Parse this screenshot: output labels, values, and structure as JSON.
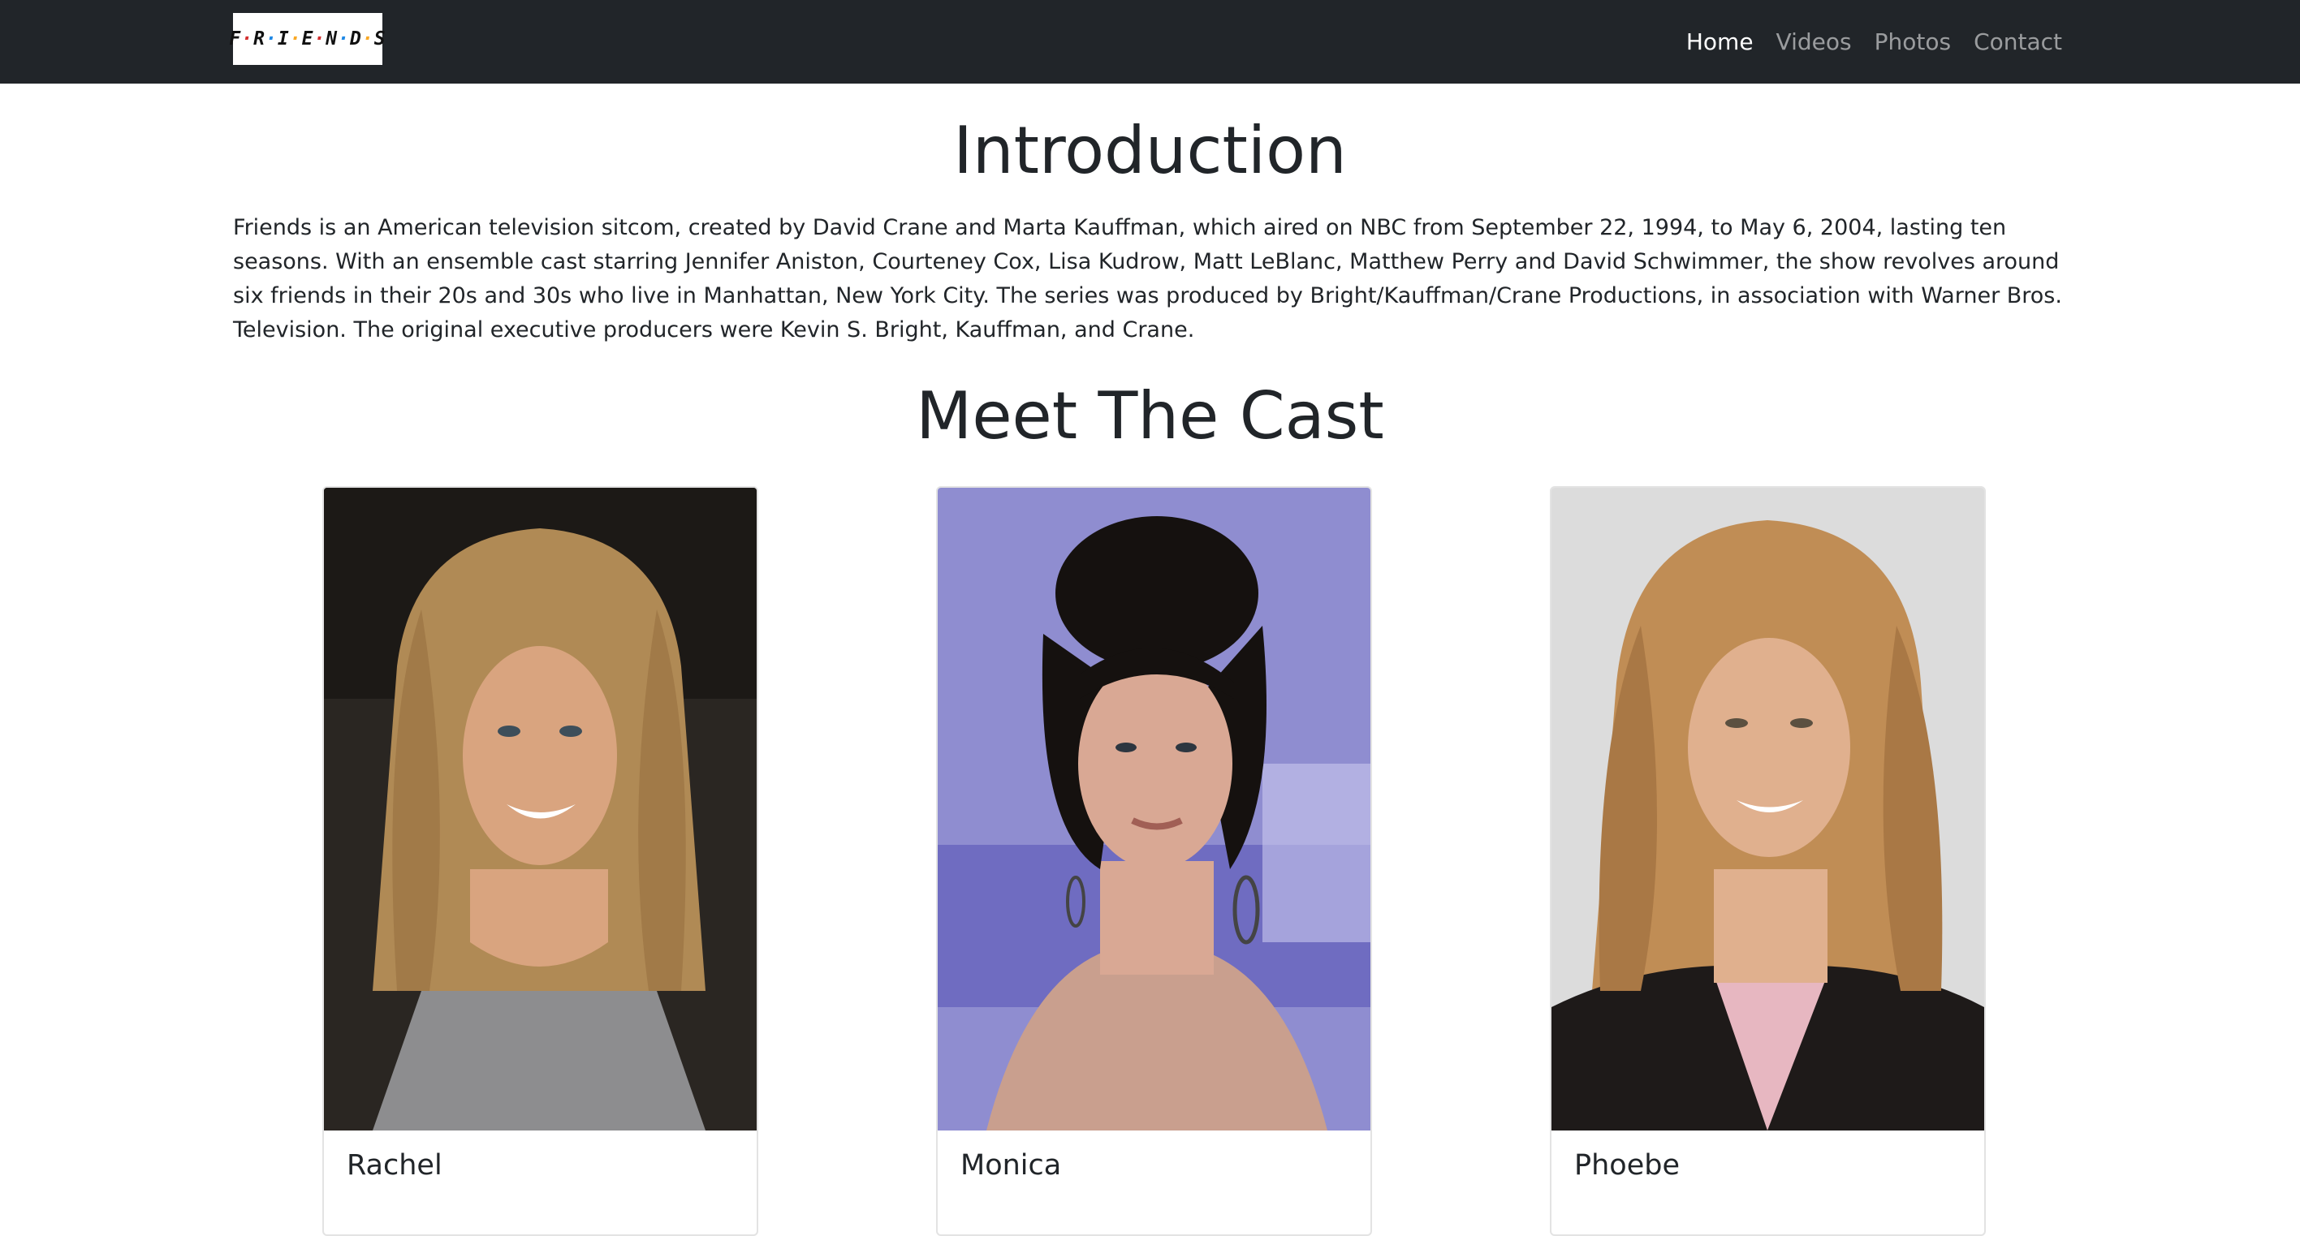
{
  "navbar": {
    "brand": {
      "letters": [
        "F",
        "R",
        "I",
        "E",
        "N",
        "D",
        "S"
      ]
    },
    "links": [
      {
        "label": "Home",
        "active": true
      },
      {
        "label": "Videos",
        "active": false
      },
      {
        "label": "Photos",
        "active": false
      },
      {
        "label": "Contact",
        "active": false
      }
    ]
  },
  "intro": {
    "heading": "Introduction",
    "text": "Friends is an American television sitcom, created by David Crane and Marta Kauffman, which aired on NBC from September 22, 1994, to May 6, 2004, lasting ten seasons. With an ensemble cast starring Jennifer Aniston, Courteney Cox, Lisa Kudrow, Matt LeBlanc, Matthew Perry and David Schwimmer, the show revolves around six friends in their 20s and 30s who live in Manhattan, New York City. The series was produced by Bright/Kauffman/Crane Productions, in association with Warner Bros. Television. The original executive producers were Kevin S. Bright, Kauffman, and Crane."
  },
  "cast": {
    "heading": "Meet The Cast",
    "members": [
      {
        "name": "Rachel",
        "photo_bg": "#2a2622",
        "hair": "#b08a55",
        "skin": "#d9a47f",
        "top": "#8d8d8f"
      },
      {
        "name": "Monica",
        "photo_bg": "#8f8dd0",
        "hair": "#15110f",
        "skin": "#d9a894",
        "top": "#c99f8e"
      },
      {
        "name": "Phoebe",
        "photo_bg": "#dcdcdc",
        "hair": "#c08d55",
        "skin": "#e0b08e",
        "top": "#1e1a19"
      }
    ]
  },
  "colors": {
    "navbar_bg": "#212529",
    "text": "#212529",
    "nav_inactive": "rgba(255,255,255,0.55)",
    "nav_active": "#ffffff"
  }
}
